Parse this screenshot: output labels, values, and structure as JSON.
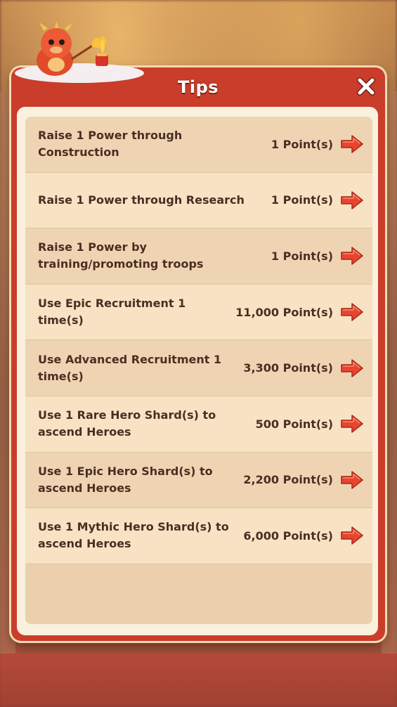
{
  "dialog": {
    "title": "Tips"
  },
  "tips": [
    {
      "label": "Raise 1 Power through Construction",
      "points": "1 Point(s)"
    },
    {
      "label": "Raise 1 Power through Research",
      "points": "1 Point(s)"
    },
    {
      "label": "Raise 1 Power by training/promoting troops",
      "points": "1 Point(s)"
    },
    {
      "label": "Use Epic Recruitment 1 time(s)",
      "points": "11,000 Point(s)"
    },
    {
      "label": "Use Advanced Recruitment 1 time(s)",
      "points": "3,300 Point(s)"
    },
    {
      "label": "Use 1 Rare Hero Shard(s) to ascend Heroes",
      "points": "500 Point(s)"
    },
    {
      "label": "Use 1 Epic Hero Shard(s) to ascend Heroes",
      "points": "2,200 Point(s)"
    },
    {
      "label": "Use 1 Mythic Hero Shard(s) to ascend Heroes",
      "points": "6,000 Point(s)"
    }
  ],
  "icons": {
    "close": "close-icon",
    "go": "arrow-right-icon",
    "mascot": "dragon-mascot"
  },
  "colors": {
    "dialog_red": "#c93d2a",
    "panel_cream": "#faf0de",
    "row_odd": "#efd4b3",
    "row_even": "#f7e2c4",
    "text_brown": "#4a2e22",
    "arrow_red": "#e8452f"
  }
}
